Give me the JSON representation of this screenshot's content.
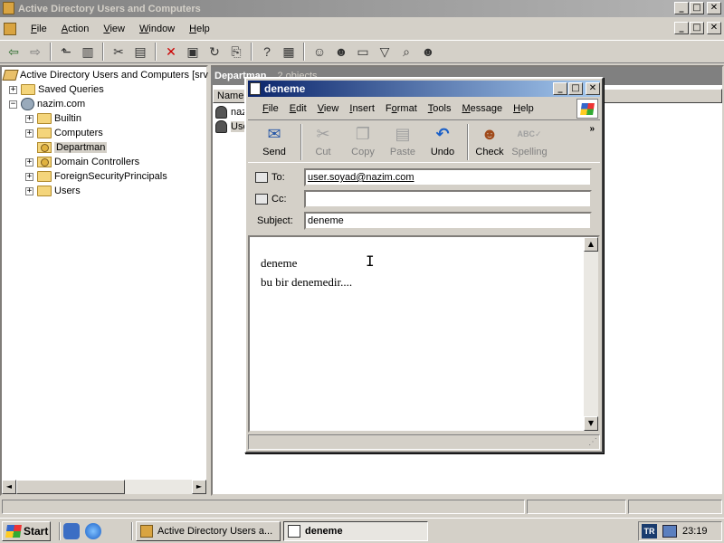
{
  "main_window": {
    "title": "Active Directory Users and Computers",
    "controls": {
      "minimize": "_",
      "maximize": "□",
      "close": "✕"
    },
    "menu": [
      {
        "label": "File",
        "u": "F",
        "rest": "ile"
      },
      {
        "label": "Action",
        "u": "A",
        "rest": "ction"
      },
      {
        "label": "View",
        "u": "V",
        "rest": "iew"
      },
      {
        "label": "Window",
        "u": "W",
        "rest": "indow"
      },
      {
        "label": "Help",
        "u": "H",
        "rest": "elp"
      }
    ],
    "toolbar_icons": [
      "back-icon",
      "forward-icon",
      "up-folder-icon",
      "show-tree-icon",
      "cut-icon",
      "paste-icon",
      "delete-icon",
      "properties-icon",
      "refresh-icon",
      "export-icon",
      "help-icon",
      "console-icon",
      "new-user-icon",
      "new-group-icon",
      "new-ou-icon",
      "filter-icon",
      "find-icon",
      "add-to-group-icon"
    ]
  },
  "tree": {
    "root_label": "Active Directory Users and Computers [srv",
    "items": [
      {
        "label": "Saved Queries",
        "toggle": "+"
      },
      {
        "label": "nazim.com",
        "toggle": "−"
      },
      {
        "label": "Builtin",
        "toggle": "+"
      },
      {
        "label": "Computers",
        "toggle": "+"
      },
      {
        "label": "Departman",
        "toggle": ""
      },
      {
        "label": "Domain Controllers",
        "toggle": "+"
      },
      {
        "label": "ForeignSecurityPrincipals",
        "toggle": "+"
      },
      {
        "label": "Users",
        "toggle": "+"
      }
    ]
  },
  "right_pane": {
    "header": "Departman",
    "subheader": "2 objects",
    "column_name": "Name",
    "rows": [
      "naz",
      "Use"
    ]
  },
  "compose": {
    "title": "deneme",
    "controls": {
      "minimize": "_",
      "maximize": "□",
      "close": "✕"
    },
    "menu": [
      {
        "label": "File",
        "u": "F",
        "rest": "ile"
      },
      {
        "label": "Edit",
        "u": "E",
        "rest": "dit"
      },
      {
        "label": "View",
        "u": "V",
        "rest": "iew"
      },
      {
        "label": "Insert",
        "u": "I",
        "rest": "nsert"
      },
      {
        "label": "Format",
        "u": "o",
        "pre": "F",
        "rest": "rmat"
      },
      {
        "label": "Tools",
        "u": "T",
        "rest": "ools"
      },
      {
        "label": "Message",
        "u": "M",
        "rest": "essage"
      },
      {
        "label": "Help",
        "u": "H",
        "rest": "elp"
      }
    ],
    "toolbar": {
      "send": "Send",
      "cut": "Cut",
      "copy": "Copy",
      "paste": "Paste",
      "undo": "Undo",
      "check": "Check",
      "spelling": "Spelling",
      "more": "»"
    },
    "to_label": "To:",
    "to_value": "user.soyad@nazim.com",
    "cc_label": "Cc:",
    "cc_value": "",
    "subject_label": "Subject:",
    "subject_value": "deneme",
    "body_line1": "deneme",
    "body_line2": "bu bir denemedir....",
    "resize_grip": "⋰"
  },
  "taskbar": {
    "start": "Start",
    "task1": "Active Directory Users a...",
    "task2": "deneme",
    "lang": "TR",
    "clock": "23:19"
  },
  "scroll_glyphs": {
    "left": "◄",
    "right": "►",
    "up": "▲",
    "down": "▼"
  }
}
